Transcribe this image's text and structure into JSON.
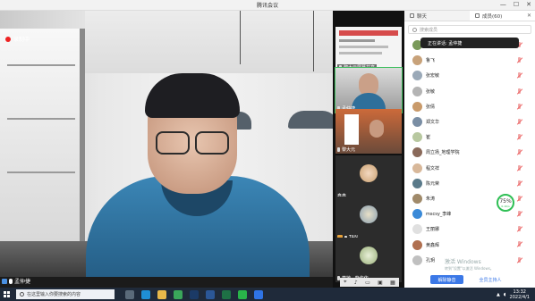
{
  "window": {
    "title": "腾讯会议",
    "minimize": "—",
    "maximize": "☐",
    "close": "✕"
  },
  "main_video": {
    "recording_label": "录制中",
    "speaker_name": "孟仲捷"
  },
  "thumbnails": [
    {
      "name": "黎大元屏幕共享"
    },
    {
      "name": "孟仲捷",
      "active": true
    },
    {
      "name": "黎大元"
    },
    {
      "name": "鑫鑫"
    },
    {
      "name": "TAN"
    },
    {
      "name": "草地 · 静依依"
    }
  ],
  "thumb_toolbar": {
    "icons": [
      "cursor-icon",
      "mic-icon",
      "video-icon",
      "screen-icon",
      "grid-icon"
    ]
  },
  "panel": {
    "tabs": [
      {
        "label": "聊天"
      },
      {
        "label": "成员(60)"
      }
    ],
    "search_placeholder": "搜索成员",
    "speaking_tip": "正在讲话: 孟仲捷",
    "members": [
      {
        "name": "孟仲捷",
        "color": "#7a9a5a"
      },
      {
        "name": "鲁飞",
        "color": "#c8a27a"
      },
      {
        "name": "张宏敏",
        "color": "#9aa9b8"
      },
      {
        "name": "张敏",
        "color": "#b4b4b4"
      },
      {
        "name": "张倩",
        "color": "#c99a6a"
      },
      {
        "name": "郑文华",
        "color": "#7a8ea4"
      },
      {
        "name": "崔",
        "color": "#b8c8a0"
      },
      {
        "name": "周立扬_地理学院",
        "color": "#8a6a5a"
      },
      {
        "name": "程文祥",
        "color": "#d8b89a"
      },
      {
        "name": "陈元荣",
        "color": "#5a7a8a"
      },
      {
        "name": "朱涛",
        "color": "#a08a6a"
      },
      {
        "name": "mscsy_李峰",
        "color": "#3a8ad8"
      },
      {
        "name": "王丽娜",
        "color": "#e0e0e0"
      },
      {
        "name": "黄鑫辉",
        "color": "#b07050"
      },
      {
        "name": "孔玥",
        "color": "#c0c0c0"
      }
    ],
    "progress": {
      "percent": "75",
      "unit": "%",
      "sub": "0.1K/s"
    },
    "buttons": {
      "primary": "解除静音",
      "secondary": "全员主持人"
    },
    "activation": {
      "line1": "激活 Windows",
      "line2": "转到\"设置\"以激活 Windows。"
    }
  },
  "taskbar": {
    "search_placeholder": "在这里输入你要搜索的内容",
    "apps": [
      {
        "name": "task-view-icon",
        "color": "#5a6a7a"
      },
      {
        "name": "edge-icon",
        "color": "#1f8fd6"
      },
      {
        "name": "file-explorer-icon",
        "color": "#e8b84a"
      },
      {
        "name": "chrome-icon",
        "color": "#3aa65a"
      },
      {
        "name": "photoshop-icon",
        "color": "#1b3a66"
      },
      {
        "name": "word-icon",
        "color": "#2b5797"
      },
      {
        "name": "excel-icon",
        "color": "#1e7145"
      },
      {
        "name": "wechat-icon",
        "color": "#29b44a"
      },
      {
        "name": "tencent-meeting-icon",
        "color": "#2f74e6"
      }
    ],
    "time": "13:32",
    "date": "2022/4/1"
  }
}
